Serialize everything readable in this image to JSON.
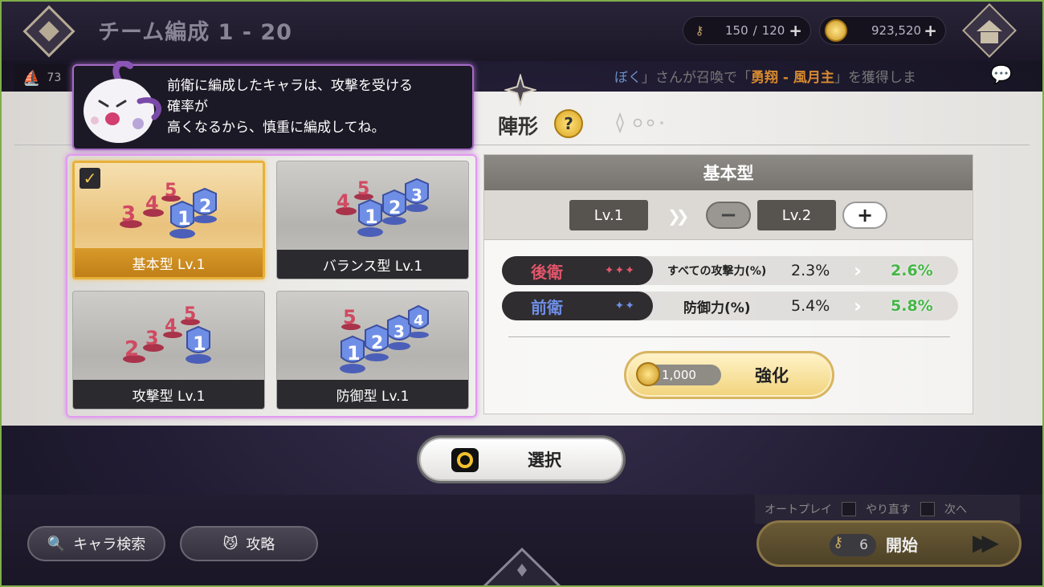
{
  "header": {
    "title": "チーム編成 1 - 20",
    "stamina": {
      "current": "150",
      "separator": "/",
      "max": "120"
    },
    "gold": "923,520"
  },
  "ticker": {
    "count": "73",
    "player": "ぼく",
    "middle": "」さんが召喚で「",
    "item": "勇翔 - 風月主",
    "tail": "」を獲得しま"
  },
  "tutorial": {
    "lines": [
      "前衛に編成したキャラは、攻撃を受ける",
      "確率が",
      "高くなるから、慎重に編成してね。"
    ]
  },
  "formation": {
    "title": "陣形",
    "help": "?",
    "options": [
      {
        "label": "基本型 Lv.1",
        "selected": true
      },
      {
        "label": "バランス型 Lv.1",
        "selected": false
      },
      {
        "label": "攻撃型 Lv.1",
        "selected": false
      },
      {
        "label": "防御型 Lv.1",
        "selected": false
      }
    ]
  },
  "detail": {
    "title": "基本型",
    "current_level": "Lv.1",
    "next_level": "Lv.2",
    "stats": [
      {
        "position": "後衛",
        "stars": "✦✦✦",
        "name": "すべての攻撃力(%)",
        "current": "2.3%",
        "next": "2.6%",
        "color": "#e2566b"
      },
      {
        "position": "前衛",
        "stars": "✦✦",
        "name": "防御力(%)",
        "current": "5.4%",
        "next": "5.8%",
        "color": "#6f8ee6"
      }
    ],
    "enhance_cost": "1,000",
    "enhance_label": "強化"
  },
  "select_label": "選択",
  "bottom": {
    "search_label": "キャラ検索",
    "guide_label": "攻略",
    "auto_label": "オートプレイ",
    "retry_label": "やり直す",
    "next_label": "次へ",
    "start_cost": "6",
    "start_label": "開始"
  },
  "colors": {
    "accent_gold": "#e7b13a",
    "rear_red": "#e2566b",
    "front_blue": "#6f8ee6",
    "bonus_green": "#44b646",
    "highlight_pink": "#e29af0"
  }
}
